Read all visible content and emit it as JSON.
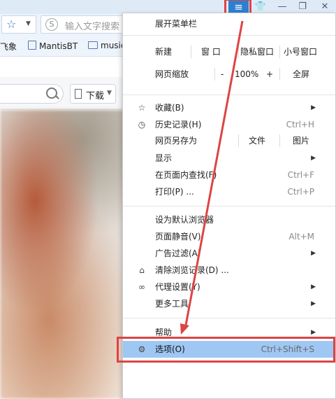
{
  "toolbar": {
    "search_placeholder": "输入文字搜索",
    "search_logo": "S",
    "download_label": "下载"
  },
  "bookmarks": [
    {
      "label": "飞象",
      "icon": "page-icon"
    },
    {
      "label": "MantisBT",
      "icon": "page-icon"
    },
    {
      "label": "music",
      "icon": "folder-icon"
    }
  ],
  "window_buttons": {
    "menu": "≡",
    "skin": "👕",
    "minimize": "—",
    "restore": "❐",
    "close": "✕"
  },
  "menu": {
    "expand_menubar": "展开菜单栏",
    "new_row": {
      "label": "新建",
      "window": "窗 口",
      "private": "隐私窗口",
      "small": "小号窗口"
    },
    "zoom_row": {
      "label": "网页缩放",
      "minus": "-",
      "value": "100%",
      "plus": "+",
      "fullscreen": "全屏"
    },
    "favorites": {
      "label": "收藏(B)",
      "icon": "star-icon"
    },
    "history": {
      "label": "历史记录(H)",
      "shortcut": "Ctrl+H",
      "icon": "clock-icon"
    },
    "save_as": {
      "label": "网页另存为",
      "file": "文件",
      "image": "图片"
    },
    "display": {
      "label": "显示"
    },
    "find": {
      "label": "在页面内查找(F)",
      "shortcut": "Ctrl+F"
    },
    "print": {
      "label": "打印(P) ...",
      "shortcut": "Ctrl+P"
    },
    "default_browser": {
      "label": "设为默认浏览器"
    },
    "mute": {
      "label": "页面静音(V)",
      "shortcut": "Alt+M"
    },
    "adblock": {
      "label": "广告过滤(A)"
    },
    "clear_history": {
      "label": "清除浏览记录(D) ...",
      "icon": "broom-icon"
    },
    "proxy": {
      "label": "代理设置(Y)",
      "icon": "link-icon"
    },
    "more_tools": {
      "label": "更多工具"
    },
    "help": {
      "label": "帮助"
    },
    "options": {
      "label": "选项(O)",
      "shortcut": "Ctrl+Shift+S",
      "icon": "gear-icon"
    }
  },
  "colors": {
    "accent": "#2f7fd1",
    "selected_bg": "#9fc7f3",
    "annotation_red": "#dd4444"
  }
}
